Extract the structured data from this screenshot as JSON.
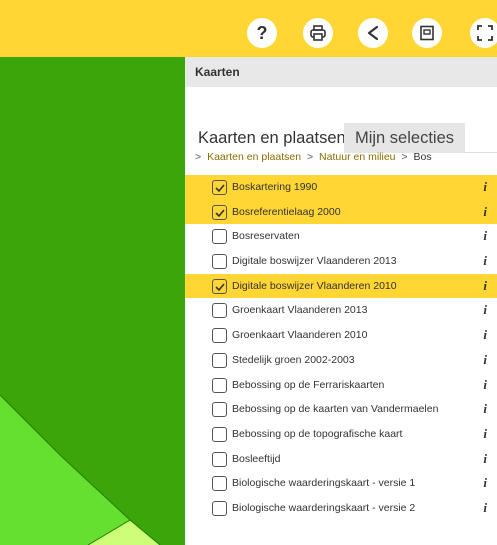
{
  "colors": {
    "accent": "#ffd633",
    "map_dark_green": "#3aa60a",
    "map_light_green": "#66e02e",
    "map_pale_green": "#ccff77"
  },
  "toolbar": {
    "buttons": [
      {
        "name": "help-button",
        "icon": "question-icon"
      },
      {
        "name": "print-button",
        "icon": "printer-icon"
      },
      {
        "name": "share-button",
        "icon": "share-icon"
      },
      {
        "name": "window-button",
        "icon": "window-icon"
      },
      {
        "name": "fullscreen-button",
        "icon": "fullscreen-icon"
      }
    ]
  },
  "panel": {
    "title": "Kaarten",
    "tabs": [
      {
        "label": "Kaarten en plaatsen",
        "active": true
      },
      {
        "label": "Mijn selecties",
        "active": false
      }
    ],
    "breadcrumb": {
      "prefix": ">",
      "items": [
        "Kaarten en plaatsen",
        "Natuur en milieu"
      ],
      "separator": ">",
      "current": "Bos"
    },
    "info_glyph": "i",
    "layers": [
      {
        "label": "Boskartering 1990",
        "checked": true
      },
      {
        "label": "Bosreferentielaag 2000",
        "checked": true
      },
      {
        "label": "Bosreservaten",
        "checked": false
      },
      {
        "label": "Digitale boswijzer Vlaanderen 2013",
        "checked": false
      },
      {
        "label": "Digitale boswijzer Vlaanderen 2010",
        "checked": true
      },
      {
        "label": "Groenkaart Vlaanderen 2013",
        "checked": false
      },
      {
        "label": "Groenkaart Vlaanderen 2010",
        "checked": false
      },
      {
        "label": "Stedelijk groen 2002-2003",
        "checked": false
      },
      {
        "label": "Bebossing op de Ferrariskaarten",
        "checked": false
      },
      {
        "label": "Bebossing op de kaarten van Vandermaelen",
        "checked": false
      },
      {
        "label": "Bebossing op de topografische kaart",
        "checked": false
      },
      {
        "label": "Bosleeftijd",
        "checked": false
      },
      {
        "label": "Biologische waarderingskaart - versie 1",
        "checked": false
      },
      {
        "label": "Biologische waarderingskaart - versie 2",
        "checked": false
      }
    ]
  }
}
